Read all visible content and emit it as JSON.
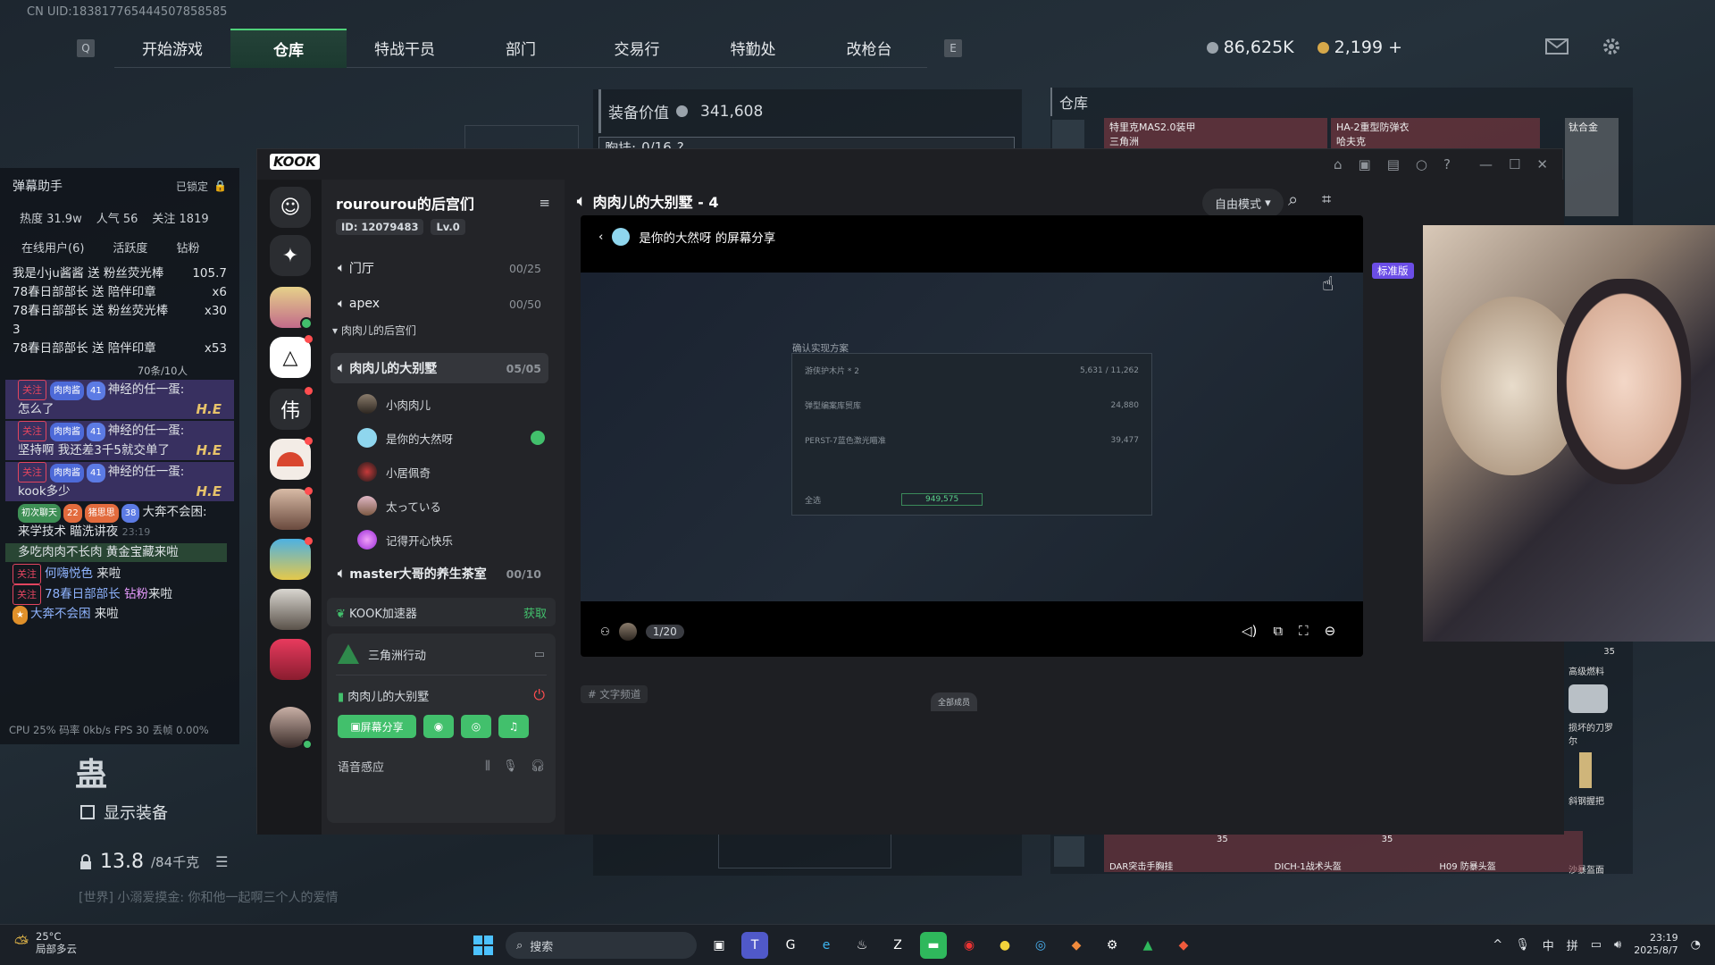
{
  "game": {
    "uid": "CN UID:183817765444507858585",
    "nav_key_left": "Q",
    "nav_key_right": "E",
    "tabs": [
      "开始游戏",
      "仓库",
      "特战干员",
      "部门",
      "交易行",
      "特勤处",
      "改枪台"
    ],
    "active_tab": "仓库",
    "currency_a": "86,625K",
    "currency_b": "2,199 +",
    "equip_title": "装备价值",
    "equip_value": "341,608",
    "chest_label": "胸挂:",
    "chest_value": "0/16",
    "chest_hint": "?",
    "warehouse_title": "仓库",
    "items": {
      "item1": "特里克MAS2.0装甲",
      "item1_sub": "三角洲",
      "item2": "HA-2重型防弹衣",
      "item2_sub": "哈夫克",
      "item3": "钛合金",
      "count_35a": "35",
      "count_35b": "35",
      "count_35c": "35",
      "fuel": "高级燃料",
      "bottom1": "DAR突击手胸挂",
      "bottom2": "DICH-1战术头盔",
      "bottom3": "H09 防暴头盔",
      "r1": "损坏的刀罗尔",
      "r2": "斜钢握把",
      "r3": "沙暴盔面"
    },
    "bag_char": "蛊",
    "show_equip": "显示装备",
    "weight": "13.8",
    "weight_max": "/84千克",
    "world_chat": "[世界] 小溺爱摸金: 你和他一起啊三个人的爱情"
  },
  "danmaku": {
    "title": "弹幕助手",
    "locked": "已锁定",
    "heat": "热度 31.9w",
    "popularity": "人气 56",
    "follow": "关注 1819",
    "tabs": [
      "在线用户(6)",
      "活跃度",
      "钻粉"
    ],
    "gifts": [
      {
        "text": "我是小ju酱酱 送 粉丝荧光棒",
        "extra": "105.7"
      },
      {
        "text": "78春日部部长 送 陪伴印章",
        "extra": "x6"
      },
      {
        "text": "78春日部部长 送 粉丝荧光棒",
        "extra": "x30"
      },
      {
        "text": "3",
        "extra": ""
      },
      {
        "text": "78春日部部长 送 陪伴印章",
        "extra": "x53"
      }
    ],
    "rate": "70条/10人",
    "follow_tag": "关注",
    "level41": "41",
    "fan_badge": "肉肉酱",
    "nick": "神经的任一蛋:",
    "messages": [
      {
        "text": "怎么了"
      },
      {
        "text": "坚持啊 我还差3千5就交单了"
      },
      {
        "text": "kook多少"
      }
    ],
    "he": "H.E",
    "m4_badge": "初次聊天",
    "m4_lv1": "22",
    "m4_fan": "猪思思",
    "m4_lv2": "38",
    "m4_nick": "大奔不会困:",
    "m4_text": "来学技术 瞄洗讲夜",
    "m4_time": "23:19",
    "m5": "多吃肉肉不长肉 黄金宝藏来啦",
    "j1_nick": "何嗨悦色",
    "j1_text": "来啦",
    "j2_nick": "78春日部部长",
    "j2_role": "钻粉",
    "j2_text": "来啦",
    "j3_nick": "大奔不会困",
    "j3_text": "来啦",
    "perf": "CPU 25%  码率 0kb/s  FPS 30     丢帧 0.00%"
  },
  "kook": {
    "logo": "KOOK",
    "server_name": "rourourou的后宫们",
    "server_id": "ID: 12079483",
    "server_lv": "Lv.0",
    "channels": [
      {
        "name": "门厅",
        "count": "00/25"
      },
      {
        "name": "apex",
        "count": "00/50"
      }
    ],
    "category": "肉肉儿的后宫们",
    "active_channel": {
      "name": "肉肉儿的大别墅",
      "count": "05/05"
    },
    "users": [
      "小肉肉儿",
      "是你的大然呀",
      "小居佩奇",
      "太っている",
      "记得开心快乐"
    ],
    "channel3": {
      "name": "master大哥的养生茶室",
      "count": "00/10"
    },
    "accelerator": "KOOK加速器",
    "accel_action": "获取",
    "game_name": "三角洲行动",
    "voice_channel": "肉肉儿的大别墅",
    "screen_share_btn": "屏幕分享",
    "voice_sense": "语音感应",
    "room_title": "肉肉儿的大别墅 - 4",
    "mode": "自由模式",
    "share_title": "是你的大然呀 的屏幕分享",
    "quality": "标准版",
    "viewer_count": "1/20",
    "text_channel": "# 文字频道",
    "all_members": "全部成员",
    "inner": {
      "dialog_title": "确认实现方案",
      "r1_name": "游侠护木片 * 2",
      "r1_v1": "5,631",
      "r1_v2": "11,262",
      "r2_name": "弹型编案库贸库",
      "r2_v": "24,880",
      "r3_name": "PERST-7蓝色激光瞄准",
      "r3_v": "39,477",
      "total": "949,575",
      "all": "全选"
    }
  },
  "taskbar": {
    "temp": "25°C",
    "weather": "局部多云",
    "search": "搜索",
    "ime1": "中",
    "ime2": "拼",
    "time": "23:19",
    "date": "2025/8/7"
  }
}
